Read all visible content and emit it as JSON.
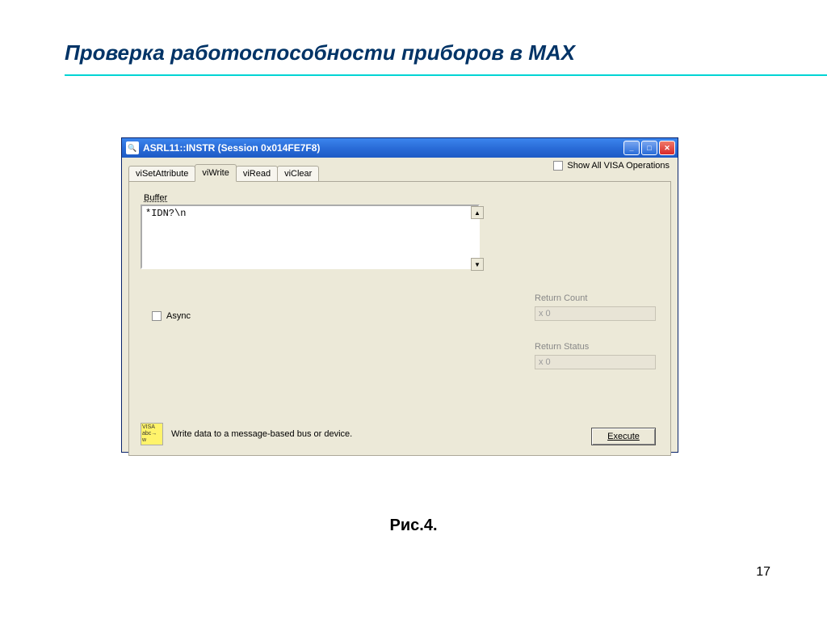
{
  "slide": {
    "title": "Проверка работоспособности  приборов в MAX",
    "figure_caption": "Рис.4.",
    "page_number": "17"
  },
  "window": {
    "titlebar_text": "ASRL11::INSTR (Session 0x014FE7F8)",
    "show_all_label": "Show All VISA Operations",
    "tabs": {
      "setattr": "viSetAttribute",
      "write": "viWrite",
      "read": "viRead",
      "clear": "viClear"
    },
    "buffer": {
      "legend": "Buffer",
      "value": "*IDN?\\n"
    },
    "async_label": "Async",
    "return_count": {
      "label": "Return Count",
      "value": "x 0"
    },
    "return_status": {
      "label": "Return Status",
      "value": "x 0"
    },
    "help_text": "Write data to a message-based bus or device.",
    "help_icon_text": "VISA abc→ w",
    "execute_label_pre": "E",
    "execute_label_post": "xecute"
  }
}
